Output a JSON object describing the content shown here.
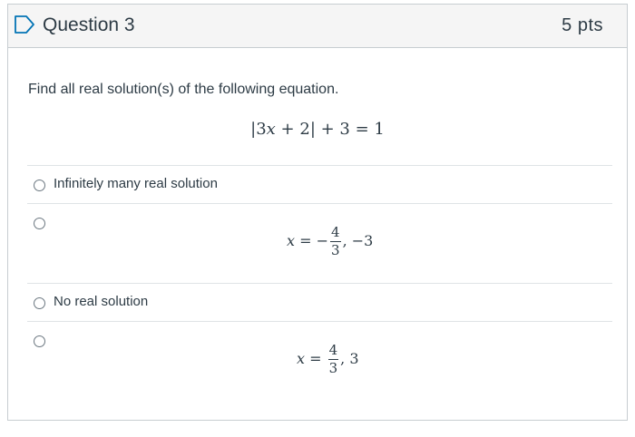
{
  "question": {
    "title": "Question 3",
    "points": "5 pts",
    "prompt": "Find all real solution(s) of the following equation."
  },
  "equation": {
    "abs_open": "|",
    "coef": "3",
    "var": "x",
    "plus_two": " + 2",
    "abs_close": "|",
    "rest": " + 3 = 1"
  },
  "options": [
    {
      "label": "Infinitely many real solution"
    },
    {
      "var": "x",
      "eq": " = −",
      "num": "4",
      "den": "3",
      "tail": ", −3"
    },
    {
      "label": "No real solution"
    },
    {
      "var": "x",
      "eq": " = ",
      "num": "4",
      "den": "3",
      "tail": ", 3"
    }
  ]
}
